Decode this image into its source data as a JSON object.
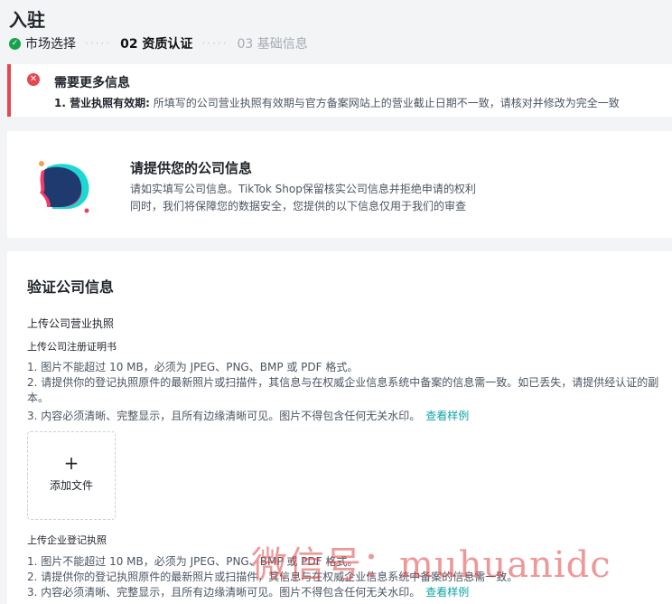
{
  "page": {
    "title": "入驻"
  },
  "steps": [
    {
      "label": "市场选择",
      "state": "done"
    },
    {
      "label": "02 资质认证",
      "state": "current"
    },
    {
      "label": "03 基础信息",
      "state": "pending"
    }
  ],
  "alert": {
    "title": "需要更多信息",
    "detail_prefix": "1. 营业执照有效期:",
    "detail_text": " 所填写的公司营业执照有效期与官方备案网站上的营业截止日期不一致，请核对并修改为完全一致",
    "color": "#e5474e"
  },
  "intro": {
    "title": "请提供您的公司信息",
    "line1": "请如实填写公司信息。TikTok Shop保留核实公司信息并拒绝申请的权利",
    "line2": "同时，我们将保障您的数据安全，您提供的以下信息仅用于我们的审查"
  },
  "verify": {
    "title": "验证公司信息",
    "upload_label": "上传公司营业执照",
    "section1": {
      "label": "上传公司注册证明书",
      "rules": [
        "1. 图片不能超过 10 MB，必须为 JPEG、PNG、BMP 或 PDF 格式。",
        "2. 请提供你的登记执照原件的最新照片或扫描件，其信息与在权威企业信息系统中备案的信息需一致。如已丢失，请提供经认证的副本。",
        "3. 内容必须清晰、完整显示，且所有边缘清晰可见。图片不得包含任何无关水印。"
      ],
      "example_link": "查看样例",
      "upload_button": "添加文件"
    },
    "section2": {
      "label": "上传企业登记执照",
      "rules": [
        "1. 图片不能超过 10 MB，必须为 JPEG、PNG、BMP 或 PDF 格式。",
        "2. 请提供你的登记执照原件的最新照片或扫描件，其信息与在权威企业信息系统中备案的信息需一致。",
        "3. 内容必须清晰、完整显示，且所有边缘清晰可见。图片不得包含任何无关水印。"
      ],
      "example_link": "查看样例"
    }
  },
  "watermark": {
    "text": "微信号：muhuanidc"
  },
  "colors": {
    "accent": "#0ea5a4",
    "success": "#16a34a",
    "error": "#e5474e"
  }
}
